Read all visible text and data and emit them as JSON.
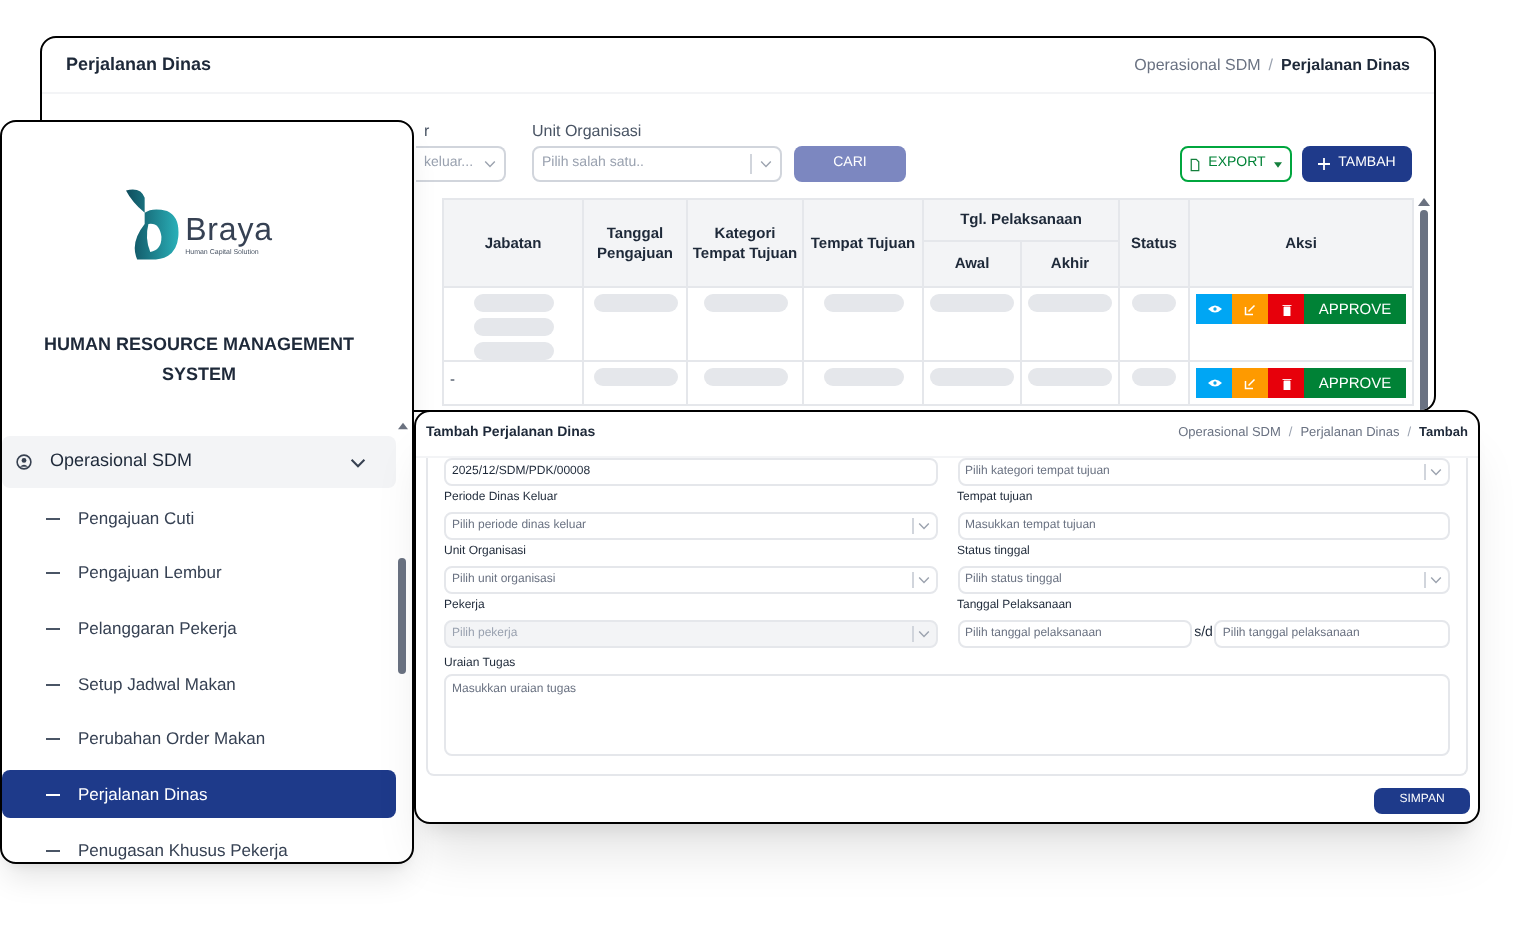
{
  "main_window": {
    "title": "Perjalanan Dinas",
    "breadcrumb": [
      {
        "label": "Operasional SDM",
        "current": false
      },
      {
        "separator": "/",
        "label": "Perjalanan Dinas",
        "current": true
      }
    ],
    "filters": [
      {
        "label": "r",
        "placeholder": "keluar..."
      },
      {
        "label": "Unit Organisasi",
        "placeholder": "Pilih salah satu.."
      }
    ],
    "search_button": "CARI",
    "export_button": "EXPORT",
    "add_button": "TAMBAH",
    "table": {
      "columns": [
        {
          "label": "Jabatan"
        },
        {
          "label": "Tanggal Pengajuan"
        },
        {
          "label": "Kategori Tempat Tujuan"
        },
        {
          "label": "Tempat Tujuan"
        },
        {
          "label": "Tgl. Pelaksanaan",
          "children": [
            {
              "label": "Awal"
            },
            {
              "label": "Akhir"
            }
          ]
        },
        {
          "label": "Status"
        },
        {
          "label": "Aksi"
        }
      ],
      "rows": [
        {
          "action": "APPROVE"
        },
        {
          "jabatan": "-",
          "action": "APPROVE"
        }
      ]
    }
  },
  "sidebar": {
    "logo": {
      "name": "Braya",
      "tagline": "Human Capital Solution"
    },
    "system_name": "HUMAN RESOURCE MANAGEMENT SYSTEM",
    "menu": [
      {
        "label": "Operasional SDM",
        "expanded": true,
        "children": [
          {
            "label": "Pengajuan Cuti",
            "selected": false
          },
          {
            "label": "Pengajuan Lembur",
            "selected": false
          },
          {
            "label": "Pelanggaran Pekerja",
            "selected": false
          },
          {
            "label": "Setup Jadwal Makan",
            "selected": false
          },
          {
            "label": "Perubahan Order Makan",
            "selected": false
          },
          {
            "label": "Perjalanan Dinas",
            "selected": true
          },
          {
            "label": "Penugasan Khusus Pekerja",
            "selected": false
          }
        ]
      }
    ]
  },
  "form_window": {
    "title": "Tambah Perjalanan Dinas",
    "breadcrumb": [
      {
        "label": "Operasional SDM",
        "current": false
      },
      {
        "separator": "/",
        "label": "Perjalanan Dinas",
        "current": false
      },
      {
        "separator": "/",
        "label": "Tambah",
        "current": true
      }
    ],
    "fields": [
      {
        "kind": "input",
        "value": "2025/12/SDM/PDK/00008"
      },
      {
        "kind": "select",
        "placeholder": "Pilih kategori tempat tujuan",
        "disabled": false
      },
      {
        "kind": "select",
        "label": "Periode Dinas Keluar",
        "placeholder": "Pilih periode dinas keluar",
        "disabled": false
      },
      {
        "kind": "input",
        "label": "Tempat tujuan",
        "placeholder": "Masukkan tempat tujuan"
      },
      {
        "kind": "select",
        "label": "Unit Organisasi",
        "placeholder": "Pilih unit organisasi",
        "disabled": false
      },
      {
        "kind": "select",
        "label": "Status tinggal",
        "placeholder": "Pilih status tinggal",
        "disabled": false
      },
      {
        "kind": "select",
        "label": "Pekerja",
        "placeholder": "Pilih pekerja",
        "disabled": true
      },
      {
        "kind": "date_range",
        "label": "Tanggal Pelaksanaan",
        "start_placeholder": "Pilih tanggal pelaksanaan",
        "separator": "s/d",
        "end_placeholder": "Pilih tanggal pelaksanaan"
      }
    ],
    "description": {
      "label": "Uraian Tugas",
      "placeholder": "Masukkan uraian tugas"
    },
    "save_button": "SIMPAN"
  }
}
